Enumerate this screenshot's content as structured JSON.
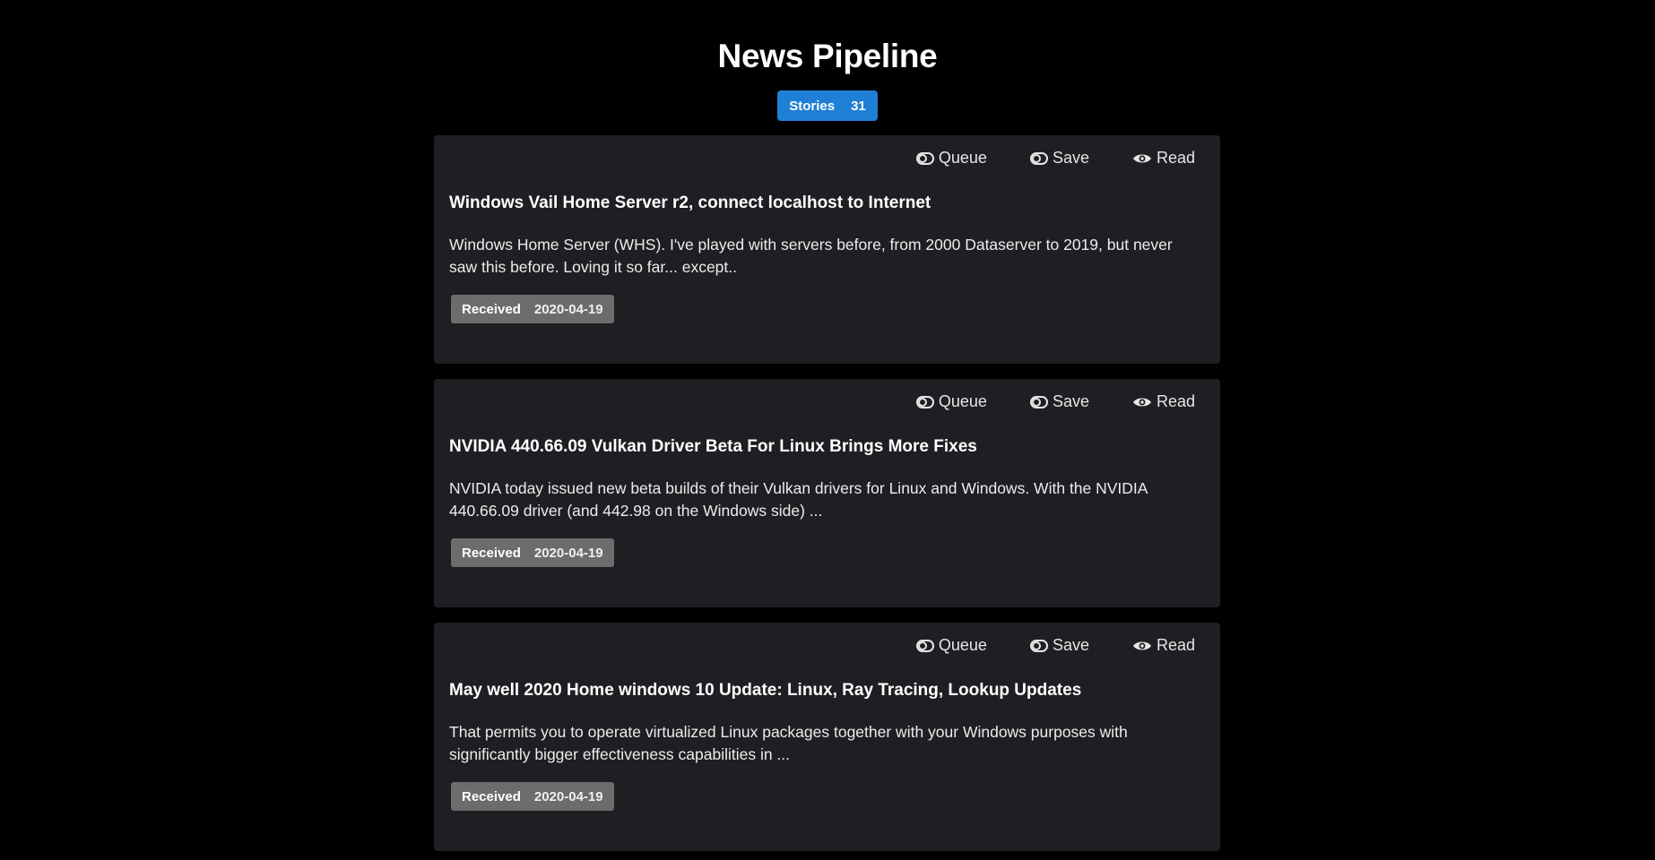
{
  "header": {
    "title": "News Pipeline",
    "stories_label": "Stories",
    "stories_count": "31"
  },
  "actions": {
    "queue_label": "Queue",
    "save_label": "Save",
    "read_label": "Read"
  },
  "stories": [
    {
      "title": "Windows Vail Home Server r2, connect localhost to Internet",
      "summary": "Windows Home Server (WHS). I've played with servers before, from 2000 Dataserver to 2019, but never saw this before. Loving it so far... except..",
      "received_label": "Received",
      "received_date": "2020-04-19"
    },
    {
      "title": "NVIDIA 440.66.09 Vulkan Driver Beta For Linux Brings More Fixes",
      "summary": "NVIDIA today issued new beta builds of their Vulkan drivers for Linux and Windows. With the NVIDIA 440.66.09 driver (and 442.98 on the Windows side) ...",
      "received_label": "Received",
      "received_date": "2020-04-19"
    },
    {
      "title": "May well 2020 Home windows 10 Update: Linux, Ray Tracing, Lookup Updates",
      "summary": "That permits you to operate virtualized Linux packages together with your Windows purposes with significantly bigger effectiveness capabilities in ...",
      "received_label": "Received",
      "received_date": "2020-04-19"
    }
  ]
}
